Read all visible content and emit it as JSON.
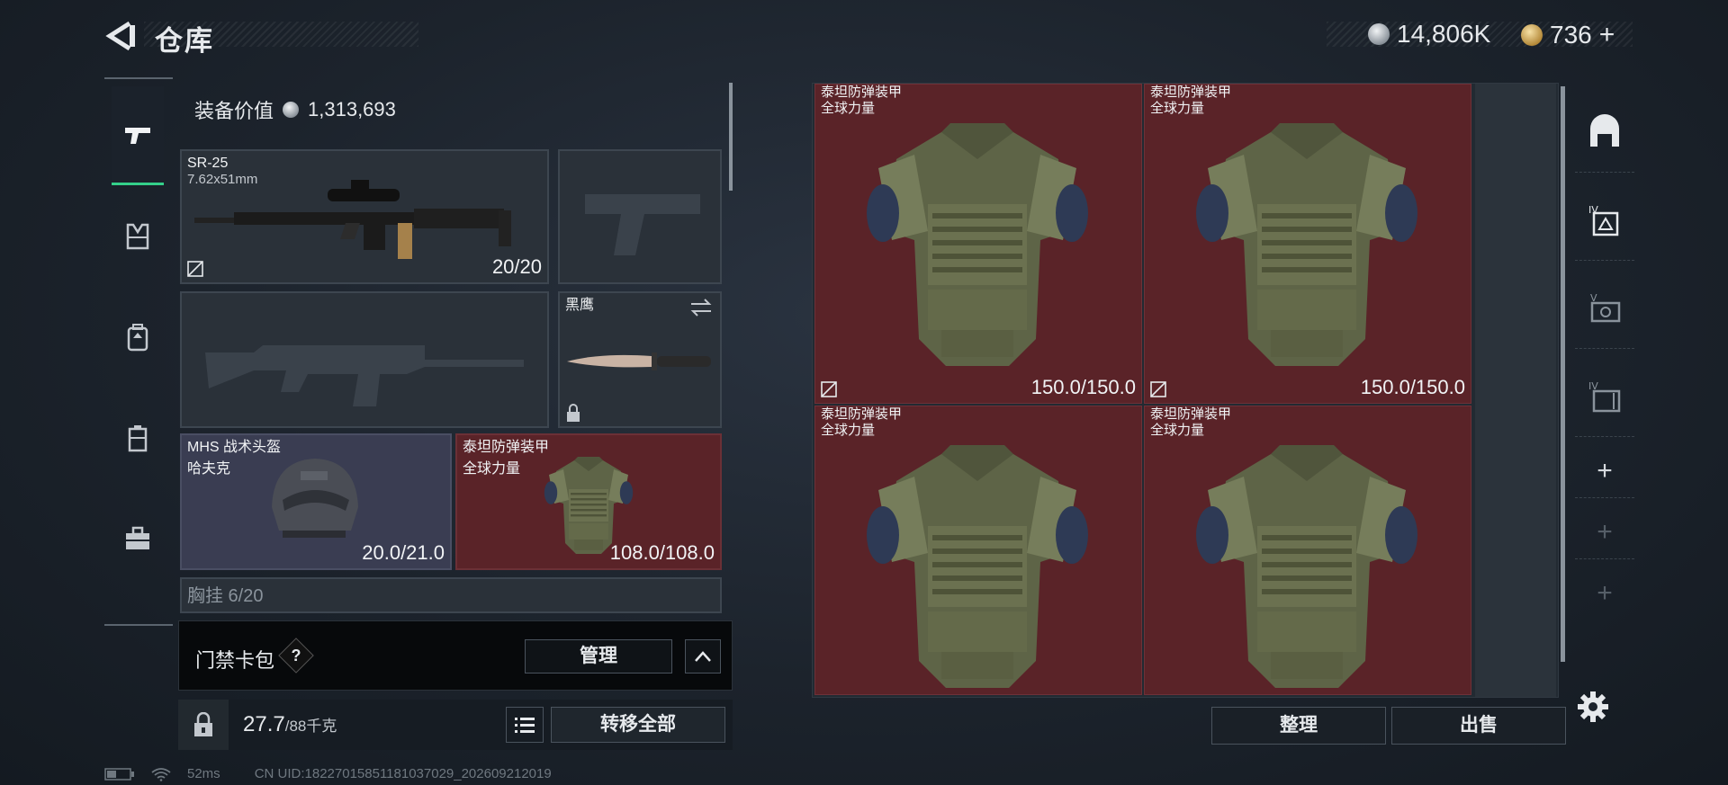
{
  "header": {
    "title": "仓库",
    "currency_silver": "14,806K",
    "currency_gold": "736"
  },
  "loadout": {
    "equipment_value_label": "装备价值",
    "equipment_value": "1,313,693",
    "primary_weapon": {
      "name": "SR-25",
      "caliber": "7.62x51mm",
      "durability": "20/20"
    },
    "melee": {
      "name": "黑鹰"
    },
    "helmet": {
      "name": "MHS 战术头盔",
      "variant": "哈夫克",
      "durability": "20.0/21.0"
    },
    "armor": {
      "name": "泰坦防弹装甲",
      "variant": "全球力量",
      "durability": "108.0/108.0"
    },
    "next_slot_partial": "胸挂 6/20"
  },
  "keycard": {
    "label": "门禁卡包",
    "help": "?",
    "manage_label": "管理"
  },
  "footer_left": {
    "weight": "27.7",
    "weight_max": "/88千克",
    "transfer_all_label": "转移全部"
  },
  "storage": {
    "items": [
      {
        "name": "泰坦防弹装甲",
        "variant": "全球力量",
        "durability": "150.0/150.0"
      },
      {
        "name": "泰坦防弹装甲",
        "variant": "全球力量",
        "durability": "150.0/150.0"
      },
      {
        "name": "泰坦防弹装甲",
        "variant": "全球力量",
        "durability": ""
      },
      {
        "name": "泰坦防弹装甲",
        "variant": "全球力量",
        "durability": ""
      }
    ],
    "sort_label": "整理",
    "sell_label": "出售"
  },
  "status": {
    "ping": "52ms",
    "uid": "CN UID:18227015851181037029_202609212019"
  },
  "colors": {
    "rare_red": "#5a2328",
    "accent_green": "#34d08a",
    "epic_purple": "#3a3d52"
  }
}
